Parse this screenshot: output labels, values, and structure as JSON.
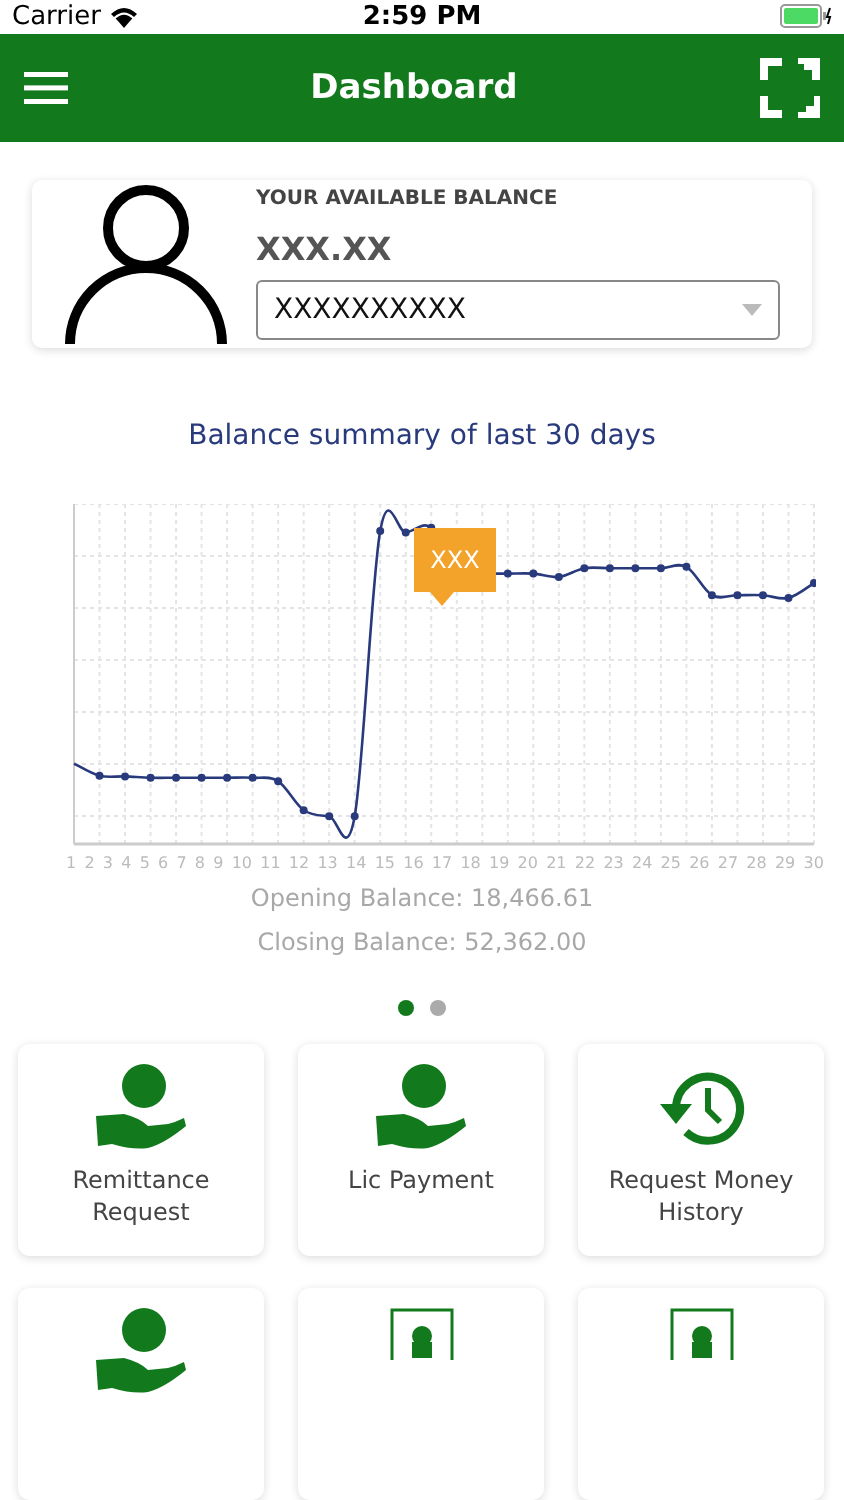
{
  "status_bar": {
    "carrier": "Carrier",
    "time": "2:59 PM"
  },
  "header": {
    "title": "Dashboard"
  },
  "balance_card": {
    "label": "YOUR AVAILABLE BALANCE",
    "amount": "XXX.XX",
    "account": "XXXXXXXXXX"
  },
  "chart": {
    "title": "Balance summary of last 30 days",
    "tooltip": "XXX",
    "x_labels": [
      "1",
      "2",
      "3",
      "4",
      "5",
      "6",
      "7",
      "8",
      "9",
      "10",
      "11",
      "12",
      "13",
      "14",
      "15",
      "16",
      "17",
      "18",
      "19",
      "20",
      "21",
      "22",
      "23",
      "24",
      "25",
      "26",
      "27",
      "28",
      "29",
      "30"
    ]
  },
  "summary": [
    "Opening Balance: 18,466.61",
    "Closing Balance: 52,362.00"
  ],
  "pager": [
    {
      "selected": true
    },
    {
      "selected": false
    }
  ],
  "tiles": [
    {
      "kind": "hand",
      "label": "Remittance Request"
    },
    {
      "kind": "hand",
      "label": "Lic Payment"
    },
    {
      "kind": "history",
      "label": "Request Money History"
    },
    {
      "kind": "hand"
    },
    {
      "kind": "frame"
    },
    {
      "kind": "frame"
    }
  ]
}
